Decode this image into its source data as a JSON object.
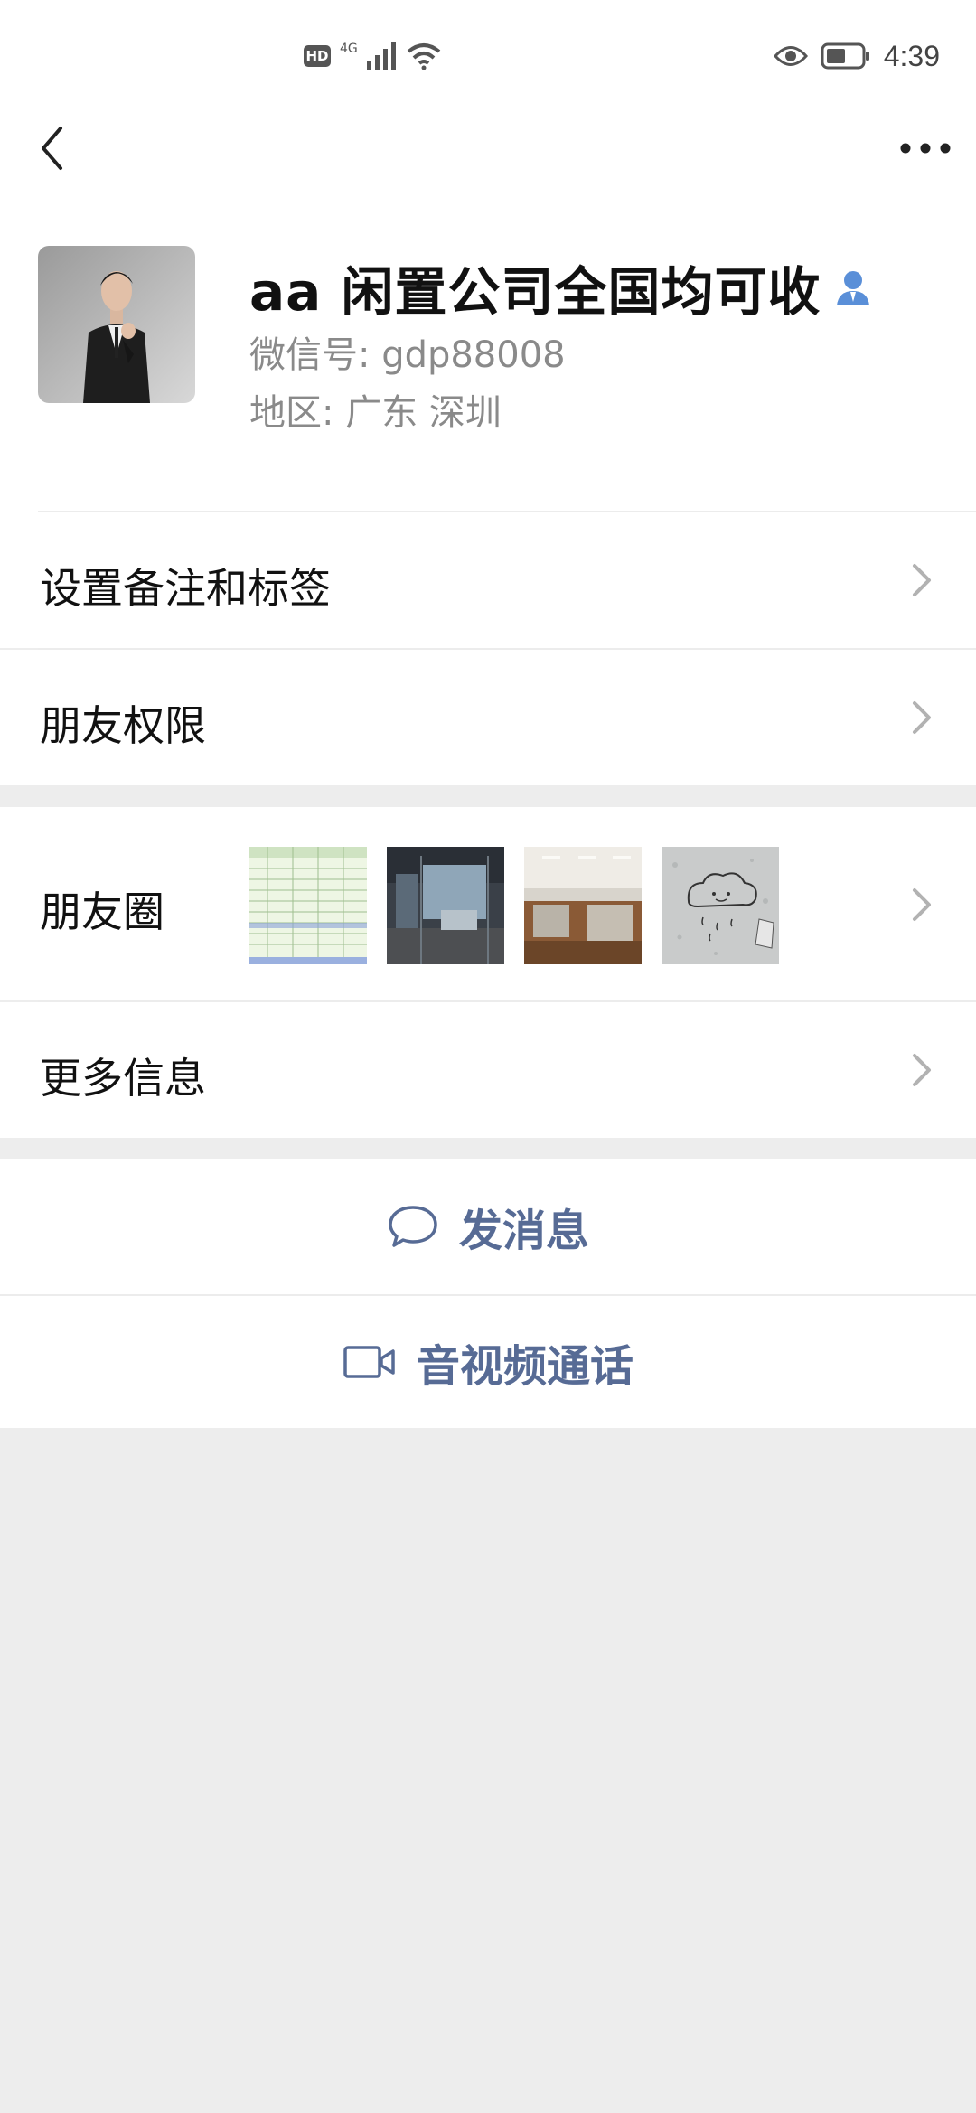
{
  "status_bar": {
    "hd": "HD",
    "network": "4G",
    "time": "4:39",
    "icons": [
      "hd-icon",
      "signal-icon",
      "wifi-icon",
      "eye-icon",
      "battery-icon"
    ]
  },
  "nav": {
    "back_icon": "chevron-left-icon",
    "more_icon": "more-dots-icon"
  },
  "profile": {
    "name": "aa 闲置公司全国均可收",
    "wechat_id": "微信号:  gdp88008",
    "region": "地区:  广东  深圳",
    "contact_icon": "person-icon"
  },
  "menu": {
    "remark": "设置备注和标签",
    "permission": "朋友权限",
    "moments": "朋友圈",
    "more_info": "更多信息"
  },
  "moments_thumbs": [
    "spreadsheet",
    "office-glass",
    "office-cubicles",
    "rain-cloud-drawing"
  ],
  "actions": {
    "message": "发消息",
    "video_call": "音视频通话"
  },
  "colors": {
    "accent": "#576b95",
    "background": "#ededed",
    "contact_icon": "#5a8fd8"
  }
}
